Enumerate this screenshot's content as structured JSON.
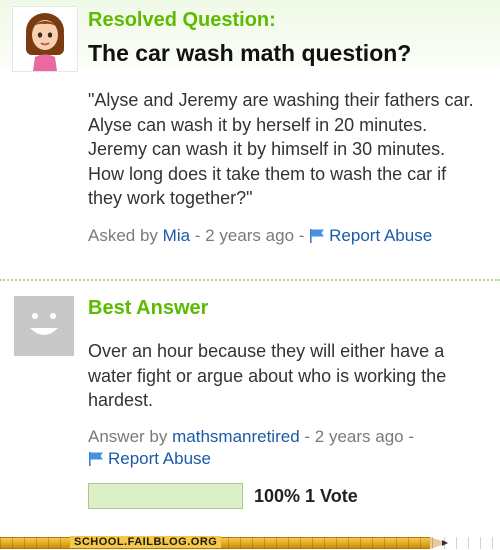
{
  "question": {
    "status_label": "Resolved Question:",
    "title": "The car wash math question?",
    "body": "\"Alyse and Jeremy are washing their fathers car. Alyse can wash it by herself in 20 minutes. Jeremy can wash it by himself in 30 minutes. How long does it take them to wash the car if they work together?\"",
    "meta": {
      "asked_by_prefix": "Asked by",
      "asker": "Mia",
      "time": " - 2 years ago - ",
      "report_label": "Report Abuse"
    }
  },
  "answer": {
    "label": "Best Answer",
    "body": "Over an hour because they will either have a water fight or argue about who is working the hardest.",
    "meta": {
      "answer_by_prefix": "Answer by",
      "answerer": "mathsmanretired",
      "time": " - 2 years ago -",
      "report_label": "Report Abuse"
    }
  },
  "rating": {
    "percent": 100,
    "label": "100% 1 Vote"
  },
  "footer": {
    "watermark": "SCHOOL.FAILBLOG.ORG"
  },
  "colors": {
    "accent_green": "#5cbb00",
    "link_blue": "#1a5aa8",
    "meta_gray": "#7a7a7a"
  },
  "icons": {
    "asker_avatar": "girl-avatar-icon",
    "answerer_avatar": "default-smiley-avatar-icon",
    "flag": "flag-icon"
  }
}
